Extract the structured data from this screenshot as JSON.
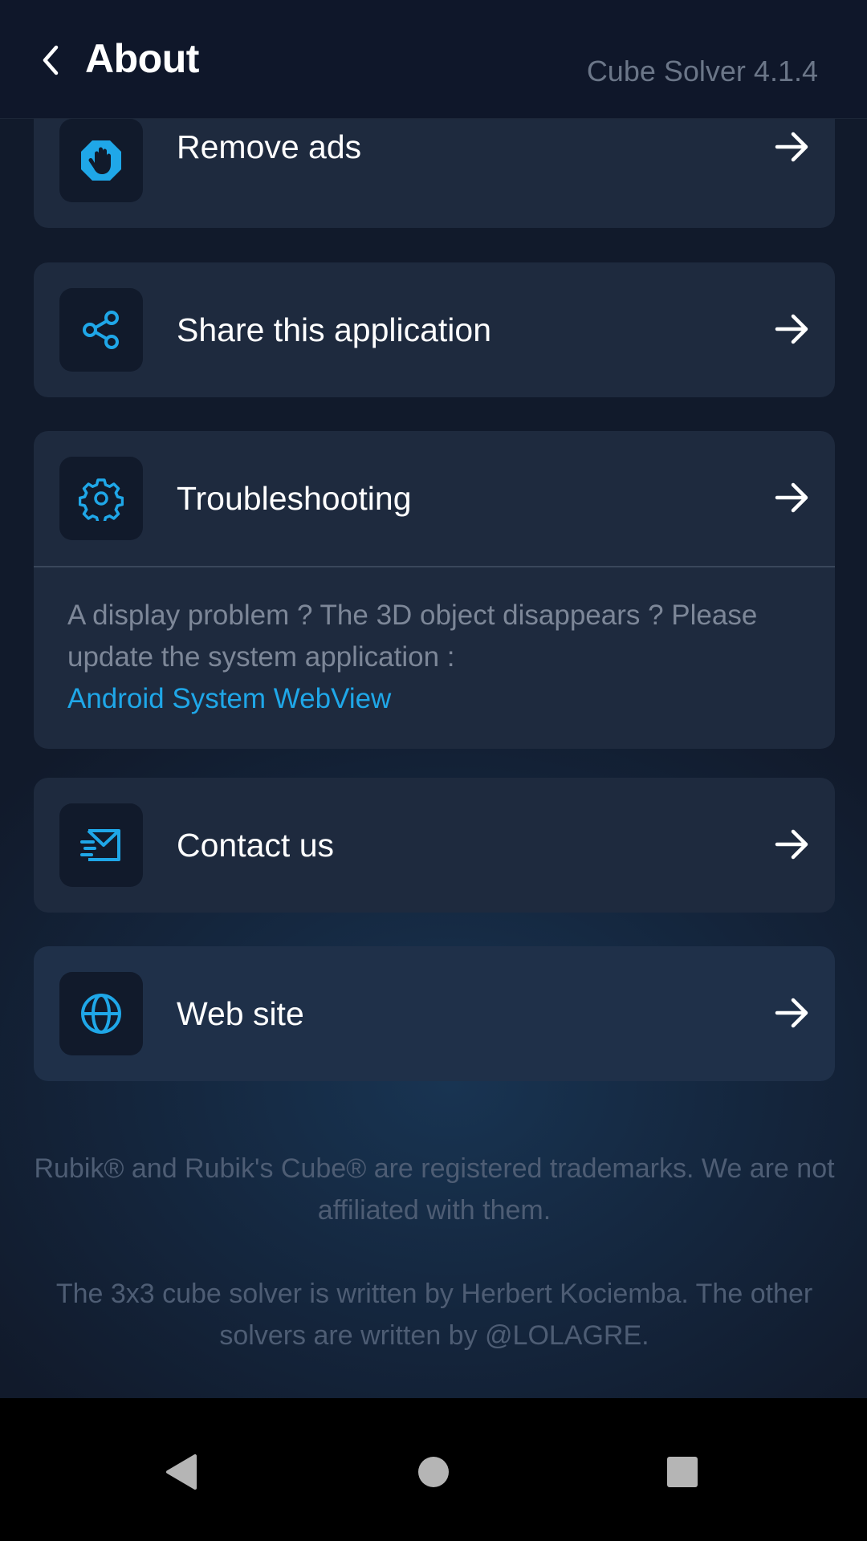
{
  "header": {
    "title": "About",
    "version": "Cube Solver 4.1.4"
  },
  "menu": [
    {
      "label": "Remove ads",
      "icon": "hand-stop-icon"
    },
    {
      "label": "Share this application",
      "icon": "share-icon"
    },
    {
      "label": "Troubleshooting",
      "icon": "gear-icon",
      "note": "A display problem ? The 3D object disappears ? Please update the system application :",
      "note_link": "Android System WebView"
    },
    {
      "label": "Contact us",
      "icon": "mail-icon"
    },
    {
      "label": "Web site",
      "icon": "globe-icon"
    }
  ],
  "footer": {
    "trademark": "Rubik® and Rubik's Cube® are registered trademarks. We are not affiliated with them.",
    "credits": "The 3x3 cube solver is written by Herbert Kociemba. The other solvers are written by @LOLAGRE."
  },
  "colors": {
    "accent": "#1fa7e8",
    "card": "#1e2a3e",
    "header": "#0f172a"
  }
}
